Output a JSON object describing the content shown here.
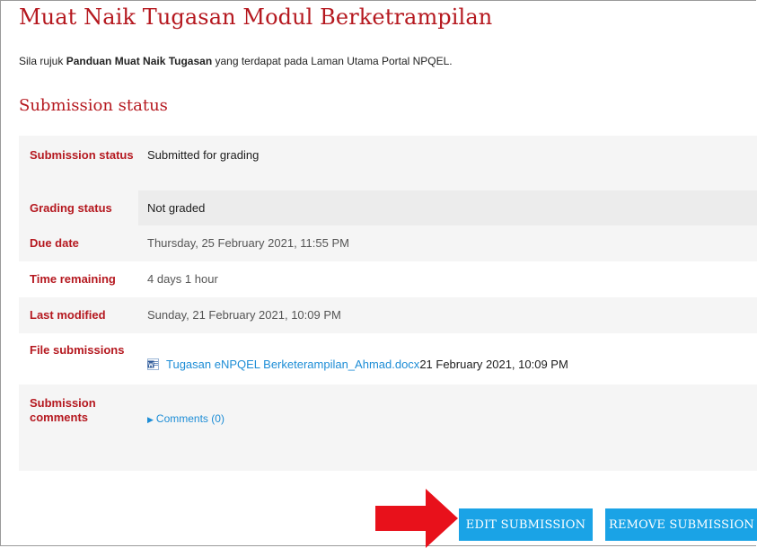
{
  "page": {
    "title": "Muat Naik Tugasan Modul Berketrampilan",
    "intro_pre": "Sila rujuk ",
    "intro_bold": "Panduan Muat Naik Tugasan",
    "intro_post": " yang terdapat pada Laman Utama Portal NPQEL."
  },
  "section": {
    "title": "Submission status"
  },
  "rows": {
    "submission_status": {
      "label": "Submission status",
      "value": "Submitted for grading"
    },
    "grading_status": {
      "label": "Grading status",
      "value": "Not graded"
    },
    "due_date": {
      "label": "Due date",
      "value": "Thursday, 25 February 2021, 11:55 PM"
    },
    "time_remaining": {
      "label": "Time remaining",
      "value": "4 days 1 hour"
    },
    "last_modified": {
      "label": "Last modified",
      "value": "Sunday, 21 February 2021, 10:09 PM"
    },
    "file_submissions": {
      "label": "File submissions",
      "file_name": "Tugasan eNPQEL Berketerampilan_Ahmad.docx",
      "file_date": "21 February 2021, 10:09 PM",
      "icon": "word-doc-icon"
    },
    "submission_comments": {
      "label": "Submission comments",
      "link": "Comments (0)"
    }
  },
  "buttons": {
    "edit": "EDIT SUBMISSION",
    "remove": "REMOVE SUBMISSION"
  },
  "colors": {
    "accent_red": "#b5181f",
    "button_blue": "#1aa3e6",
    "link_blue": "#1d8dd6",
    "arrow_red": "#e8111b"
  }
}
